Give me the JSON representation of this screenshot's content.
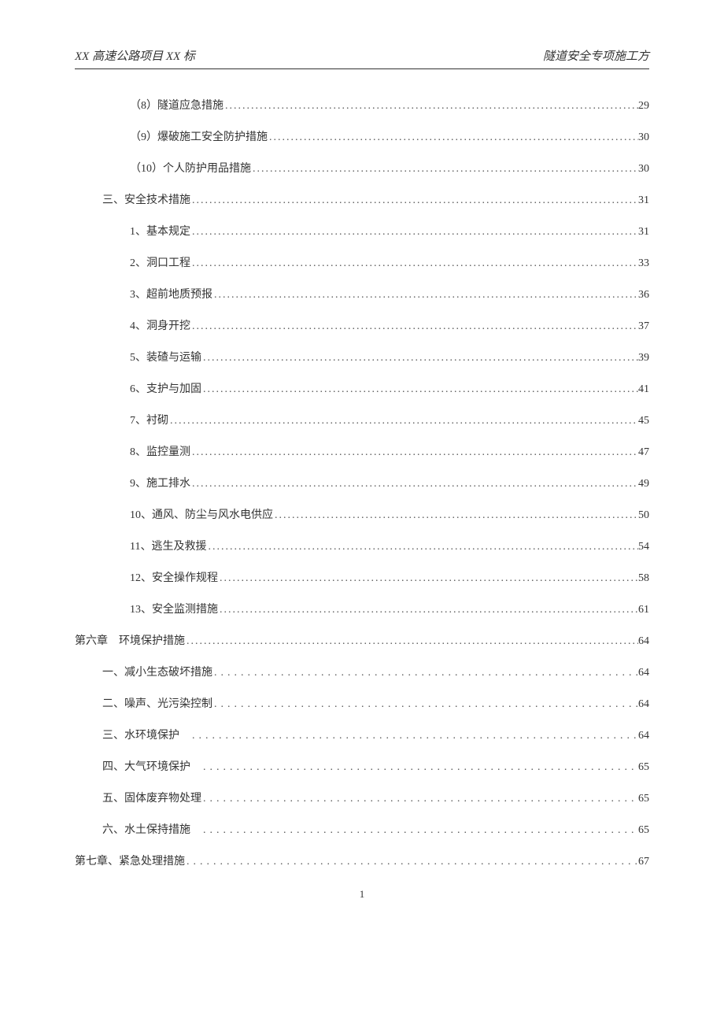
{
  "header": {
    "left": "XX 高速公路项目 XX 标",
    "right": "隧道安全专项施工方"
  },
  "toc": [
    {
      "label": "（8）隧道应急措施",
      "page": "29",
      "indent": 2,
      "dot": "narrow"
    },
    {
      "label": "（9）爆破施工安全防护措施",
      "page": "30",
      "indent": 2,
      "dot": "narrow"
    },
    {
      "label": "（10）个人防护用品措施",
      "page": "30",
      "indent": 2,
      "dot": "narrow"
    },
    {
      "label": "三、安全技术措施",
      "page": "31",
      "indent": 1,
      "dot": "narrow"
    },
    {
      "label": "1、基本规定",
      "page": "31",
      "indent": 2,
      "dot": "narrow"
    },
    {
      "label": "2、洞口工程",
      "page": "33",
      "indent": 2,
      "dot": "narrow"
    },
    {
      "label": "3、超前地质预报",
      "page": "36",
      "indent": 2,
      "dot": "narrow"
    },
    {
      "label": "4、洞身开挖",
      "page": "37",
      "indent": 2,
      "dot": "narrow"
    },
    {
      "label": "5、装碴与运输",
      "page": "39",
      "indent": 2,
      "dot": "narrow"
    },
    {
      "label": "6、支护与加固",
      "page": "41",
      "indent": 2,
      "dot": "narrow"
    },
    {
      "label": "7、衬砌",
      "page": "45",
      "indent": 2,
      "dot": "narrow"
    },
    {
      "label": "8、监控量测",
      "page": "47",
      "indent": 2,
      "dot": "narrow"
    },
    {
      "label": "9、施工排水",
      "page": "49",
      "indent": 2,
      "dot": "narrow"
    },
    {
      "label": "10、通风、防尘与风水电供应",
      "page": "50",
      "indent": 2,
      "dot": "narrow"
    },
    {
      "label": "11、逃生及救援",
      "page": "54",
      "indent": 2,
      "dot": "narrow"
    },
    {
      "label": "12、安全操作规程",
      "page": "58",
      "indent": 2,
      "dot": "narrow"
    },
    {
      "label": "13、安全监测措施",
      "page": "61",
      "indent": 2,
      "dot": "narrow"
    },
    {
      "label": "第六章　环境保护措施 ",
      "page": "64",
      "indent": 0,
      "dot": "narrow"
    },
    {
      "label": "一、减小生态破坏措施 ",
      "page": " 64",
      "indent": 1,
      "dot": "wide"
    },
    {
      "label": "二、噪声、光污染控制 ",
      "page": " 64",
      "indent": 1,
      "dot": "wide"
    },
    {
      "label": "三、水环境保护　",
      "page": " 64",
      "indent": 1,
      "dot": "wide"
    },
    {
      "label": "四、大气环境保护　",
      "page": " 65",
      "indent": 1,
      "dot": "wide"
    },
    {
      "label": "五、固体废弃物处理 ",
      "page": " 65",
      "indent": 1,
      "dot": "wide"
    },
    {
      "label": "六、水土保持措施　",
      "page": " 65",
      "indent": 1,
      "dot": "wide"
    },
    {
      "label": "第七章、紧急处理措施",
      "page": " 67",
      "indent": 0,
      "dot": "wide"
    }
  ],
  "footer": {
    "page_no": "1"
  }
}
